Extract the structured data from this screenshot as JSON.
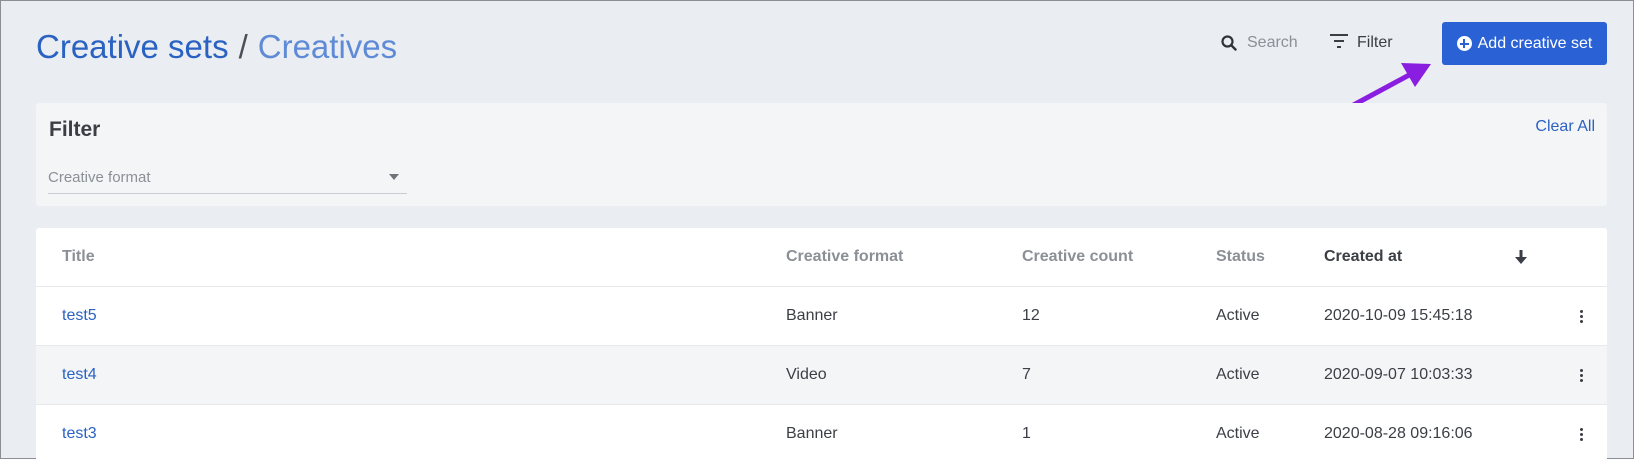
{
  "breadcrumb": {
    "primary": "Creative sets",
    "separator": "/",
    "secondary": "Creatives"
  },
  "toolbar": {
    "search_label": "Search",
    "filter_label": "Filter",
    "add_label": "Add creative set"
  },
  "filter_panel": {
    "title": "Filter",
    "clear_all": "Clear All",
    "creative_format_placeholder": "Creative format"
  },
  "table": {
    "columns": {
      "title": "Title",
      "creative_format": "Creative format",
      "creative_count": "Creative count",
      "status": "Status",
      "created_at": "Created at"
    },
    "rows": [
      {
        "title": "test5",
        "format": "Banner",
        "count": "12",
        "status": "Active",
        "created_at": "2020-10-09 15:45:18"
      },
      {
        "title": "test4",
        "format": "Video",
        "count": "7",
        "status": "Active",
        "created_at": "2020-09-07 10:03:33"
      },
      {
        "title": "test3",
        "format": "Banner",
        "count": "1",
        "status": "Active",
        "created_at": "2020-08-28 09:16:06"
      }
    ]
  },
  "colors": {
    "accent": "#2a62d6",
    "annotation_arrow": "#8a1ee0",
    "link": "#2a62c2"
  },
  "icons": {
    "search": "search-icon",
    "filter": "filter-icon",
    "add": "plus-circle-icon",
    "sort": "sort-down-icon",
    "row_menu": "kebab-menu-icon"
  }
}
